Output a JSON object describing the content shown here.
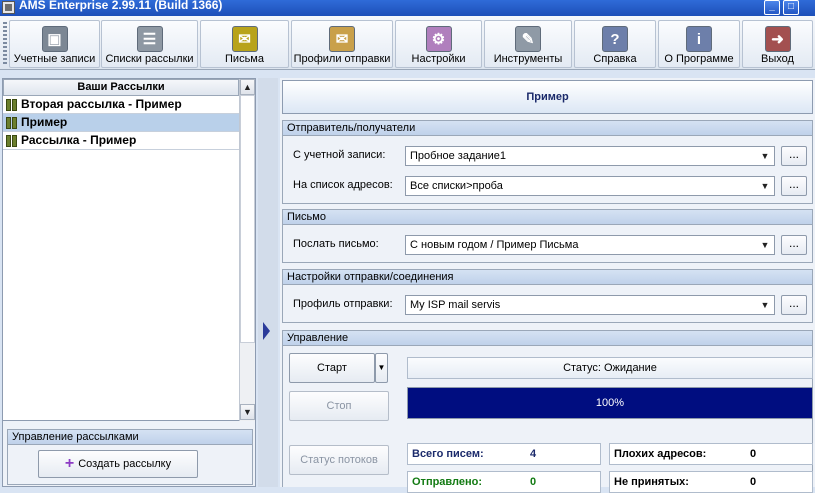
{
  "window": {
    "title": "AMS Enterprise 2.99.11 (Build 1366)"
  },
  "toolbar": {
    "buttons": [
      {
        "label": "Учетные записи",
        "icon": "accounts-icon",
        "color": "#7c8794"
      },
      {
        "label": "Списки рассылки",
        "icon": "mailing-lists-icon",
        "color": "#8e98a3"
      },
      {
        "label": "Письма",
        "icon": "letters-icon",
        "color": "#b8a31a"
      },
      {
        "label": "Профили отправки",
        "icon": "send-profiles-icon",
        "color": "#c9a04a"
      },
      {
        "label": "Настройки",
        "icon": "settings-icon",
        "color": "#b07fbd"
      },
      {
        "label": "Инструменты",
        "icon": "tools-icon",
        "color": "#8f9aa6"
      },
      {
        "label": "Справка",
        "icon": "help-icon",
        "color": "#6d7faa"
      },
      {
        "label": "О Программе",
        "icon": "about-icon",
        "color": "#6d7faa"
      },
      {
        "label": "Выход",
        "icon": "exit-icon",
        "color": "#a35050"
      }
    ]
  },
  "left": {
    "list_header": "Ваши Рассылки",
    "campaigns": [
      {
        "name": "Вторая рассылка - Пример",
        "selected": false
      },
      {
        "name": "Пример",
        "selected": true
      },
      {
        "name": "Рассылка - Пример",
        "selected": false
      }
    ],
    "manage_title": "Управление рассылками",
    "create_button": "Создать рассылку"
  },
  "right": {
    "campaign_title": "Пример",
    "sections": {
      "sender": {
        "title": "Отправитель/получатели",
        "account_label": "С учетной записи:",
        "account_value": "Пробное задание1",
        "list_label": "На список адресов:",
        "list_value": "Все списки>проба"
      },
      "letter": {
        "title": "Письмо",
        "send_label": "Послать письмо:",
        "send_value": "С новым годом / Пример Письма"
      },
      "connection": {
        "title": "Настройки отправки/соединения",
        "profile_label": "Профиль отправки:",
        "profile_value": "My ISP mail servis"
      },
      "control": {
        "title": "Управление",
        "start_button": "Старт",
        "stop_button": "Стоп",
        "threads_button": "Статус потоков",
        "status_text": "Статус: Ожидание",
        "progress_percent": 100,
        "progress_text": "100%",
        "progress_color": "#000d80",
        "stats": [
          {
            "label": "Всего писем:",
            "value": "4",
            "color": "#1b2a6b"
          },
          {
            "label": "Плохих адресов:",
            "value": "0",
            "color": "#000000"
          },
          {
            "label": "Отправлено:",
            "value": "0",
            "color": "#127a12"
          },
          {
            "label": "Не принятых:",
            "value": "0",
            "color": "#000000"
          }
        ]
      }
    }
  },
  "ellipsis_label": "...",
  "dropdown_arrow": "▼"
}
